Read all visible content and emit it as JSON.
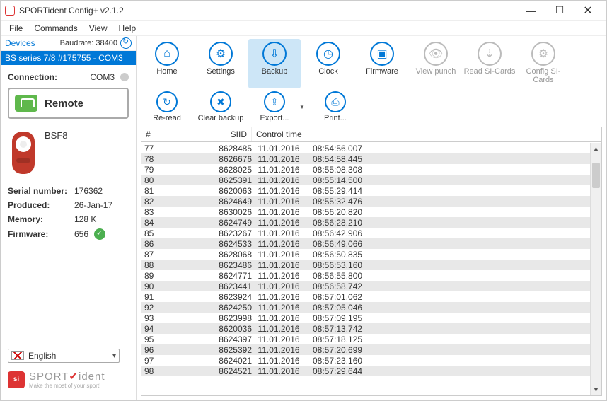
{
  "app": {
    "title": "SPORTident Config+ v2.1.2"
  },
  "menu": {
    "file": "File",
    "commands": "Commands",
    "view": "View",
    "help": "Help"
  },
  "left": {
    "devices_label": "Devices",
    "baud_label": "Baudrate: 38400",
    "selected_device": "BS series 7/8 #175755 - COM3",
    "connection_label": "Connection:",
    "connection_value": "COM3",
    "remote_label": "Remote",
    "device_type": "BSF8",
    "info": {
      "serial_k": "Serial number:",
      "serial_v": "176362",
      "produced_k": "Produced:",
      "produced_v": "26-Jan-17",
      "memory_k": "Memory:",
      "memory_v": "128 K",
      "firmware_k": "Firmware:",
      "firmware_v": "656"
    },
    "language": "English",
    "brand_main": "SPORT",
    "brand_accent": "ident",
    "brand_sub": "Make the most of your sport!"
  },
  "toolbar": {
    "home": "Home",
    "settings": "Settings",
    "backup": "Backup",
    "clock": "Clock",
    "firmware": "Firmware",
    "viewpunch": "View punch",
    "readsi": "Read SI-Cards",
    "configsi": "Config SI-Cards",
    "reread": "Re-read",
    "clear": "Clear backup",
    "export": "Export...",
    "print": "Print..."
  },
  "table": {
    "headers": {
      "idx": "#",
      "siid": "SIID",
      "ct": "Control time"
    },
    "rows": [
      {
        "idx": "77",
        "siid": "8628485",
        "date": "11.01.2016",
        "time": "08:54:56.007"
      },
      {
        "idx": "78",
        "siid": "8626676",
        "date": "11.01.2016",
        "time": "08:54:58.445"
      },
      {
        "idx": "79",
        "siid": "8628025",
        "date": "11.01.2016",
        "time": "08:55:08.308"
      },
      {
        "idx": "80",
        "siid": "8625391",
        "date": "11.01.2016",
        "time": "08:55:14.500"
      },
      {
        "idx": "81",
        "siid": "8620063",
        "date": "11.01.2016",
        "time": "08:55:29.414"
      },
      {
        "idx": "82",
        "siid": "8624649",
        "date": "11.01.2016",
        "time": "08:55:32.476"
      },
      {
        "idx": "83",
        "siid": "8630026",
        "date": "11.01.2016",
        "time": "08:56:20.820"
      },
      {
        "idx": "84",
        "siid": "8624749",
        "date": "11.01.2016",
        "time": "08:56:28.210"
      },
      {
        "idx": "85",
        "siid": "8623267",
        "date": "11.01.2016",
        "time": "08:56:42.906"
      },
      {
        "idx": "86",
        "siid": "8624533",
        "date": "11.01.2016",
        "time": "08:56:49.066"
      },
      {
        "idx": "87",
        "siid": "8628068",
        "date": "11.01.2016",
        "time": "08:56:50.835"
      },
      {
        "idx": "88",
        "siid": "8623486",
        "date": "11.01.2016",
        "time": "08:56:53.160"
      },
      {
        "idx": "89",
        "siid": "8624771",
        "date": "11.01.2016",
        "time": "08:56:55.800"
      },
      {
        "idx": "90",
        "siid": "8623441",
        "date": "11.01.2016",
        "time": "08:56:58.742"
      },
      {
        "idx": "91",
        "siid": "8623924",
        "date": "11.01.2016",
        "time": "08:57:01.062"
      },
      {
        "idx": "92",
        "siid": "8624250",
        "date": "11.01.2016",
        "time": "08:57:05.046"
      },
      {
        "idx": "93",
        "siid": "8623998",
        "date": "11.01.2016",
        "time": "08:57:09.195"
      },
      {
        "idx": "94",
        "siid": "8620036",
        "date": "11.01.2016",
        "time": "08:57:13.742"
      },
      {
        "idx": "95",
        "siid": "8624397",
        "date": "11.01.2016",
        "time": "08:57:18.125"
      },
      {
        "idx": "96",
        "siid": "8625392",
        "date": "11.01.2016",
        "time": "08:57:20.699"
      },
      {
        "idx": "97",
        "siid": "8624021",
        "date": "11.01.2016",
        "time": "08:57:23.160"
      },
      {
        "idx": "98",
        "siid": "8624521",
        "date": "11.01.2016",
        "time": "08:57:29.644"
      }
    ]
  }
}
